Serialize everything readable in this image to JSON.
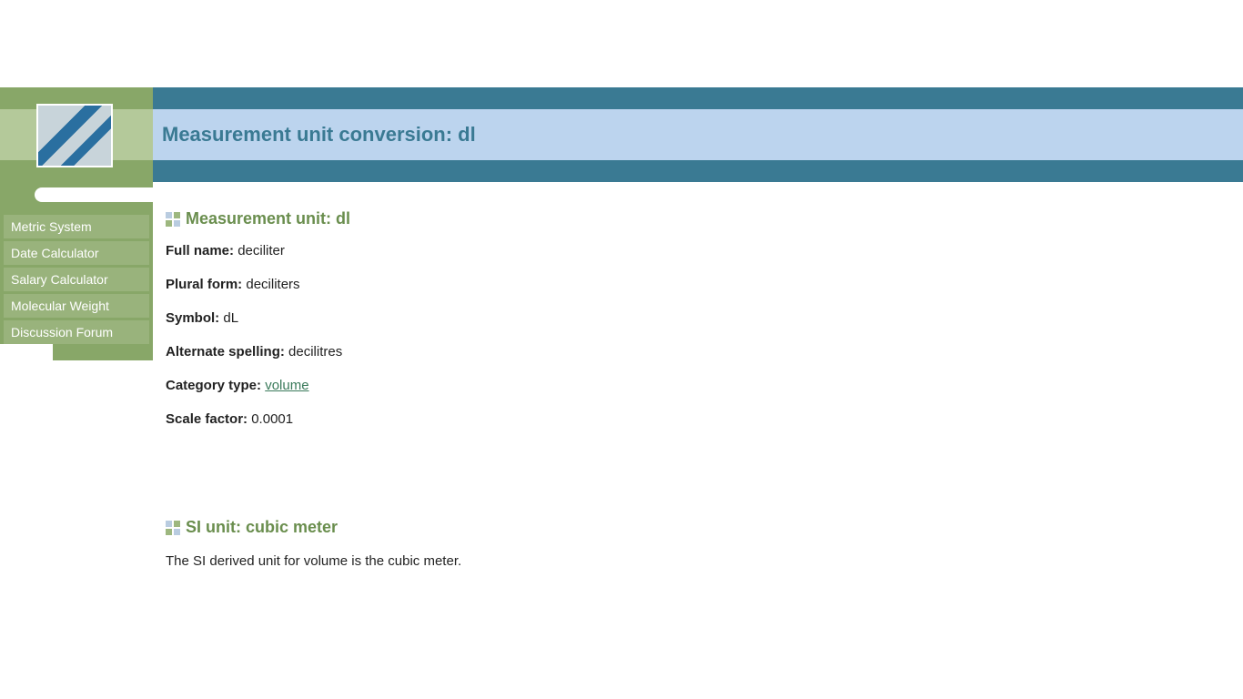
{
  "header": {
    "title": "Measurement unit conversion: dl"
  },
  "sidebar": {
    "items": [
      {
        "label": "Metric System"
      },
      {
        "label": "Date Calculator"
      },
      {
        "label": "Salary Calculator"
      },
      {
        "label": "Molecular Weight"
      },
      {
        "label": "Discussion Forum"
      }
    ]
  },
  "main": {
    "section1_title": "Measurement unit: dl",
    "fields": {
      "full_name_label": "Full name:",
      "full_name_value": "deciliter",
      "plural_label": "Plural form:",
      "plural_value": "deciliters",
      "symbol_label": "Symbol:",
      "symbol_value": "dL",
      "alt_label": "Alternate spelling:",
      "alt_value": "decilitres",
      "category_label": "Category type:",
      "category_link": "volume",
      "scale_label": "Scale factor:",
      "scale_value": "0.0001"
    },
    "si": {
      "title": "SI unit: cubic meter",
      "text": "The SI derived unit for volume is the cubic meter."
    }
  }
}
